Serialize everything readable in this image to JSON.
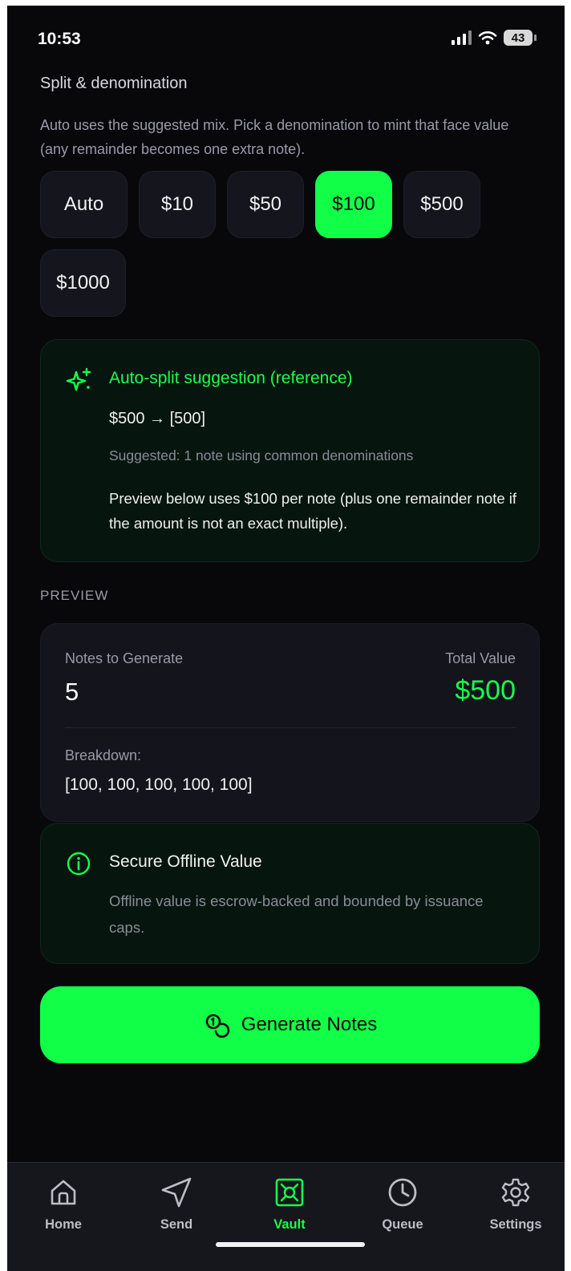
{
  "status_bar": {
    "time": "10:53",
    "battery": "43"
  },
  "split": {
    "title": "Split & denomination",
    "description": "Auto uses the suggested mix. Pick a denomination to mint that face value (any remainder becomes one extra note).",
    "options": [
      "Auto",
      "$10",
      "$50",
      "$100",
      "$500",
      "$1000"
    ],
    "selected": "$100"
  },
  "suggestion": {
    "title": "Auto-split suggestion (reference)",
    "formula": "$500 → [500]",
    "subtitle": "Suggested: 1 note using common denominations",
    "note": "Preview below uses $100 per note (plus one remainder note if the amount is not an exact multiple)."
  },
  "preview": {
    "label": "PREVIEW",
    "notes_label": "Notes to Generate",
    "notes_value": "5",
    "total_label": "Total Value",
    "total_value": "$500",
    "breakdown_label": "Breakdown:",
    "breakdown_value": "[100, 100, 100, 100, 100]"
  },
  "secure": {
    "title": "Secure Offline Value",
    "body": "Offline value is escrow-backed and bounded by issuance caps."
  },
  "generate_button": {
    "label": "Generate Notes"
  },
  "tabs": [
    {
      "label": "Home",
      "icon": "home-icon"
    },
    {
      "label": "Send",
      "icon": "send-icon"
    },
    {
      "label": "Vault",
      "icon": "vault-icon",
      "active": true
    },
    {
      "label": "Queue",
      "icon": "clock-icon"
    },
    {
      "label": "Settings",
      "icon": "gear-icon"
    }
  ],
  "colors": {
    "accent": "#12ff47",
    "background": "#08080b",
    "card": "#14141c",
    "card_green": "#06160e"
  }
}
